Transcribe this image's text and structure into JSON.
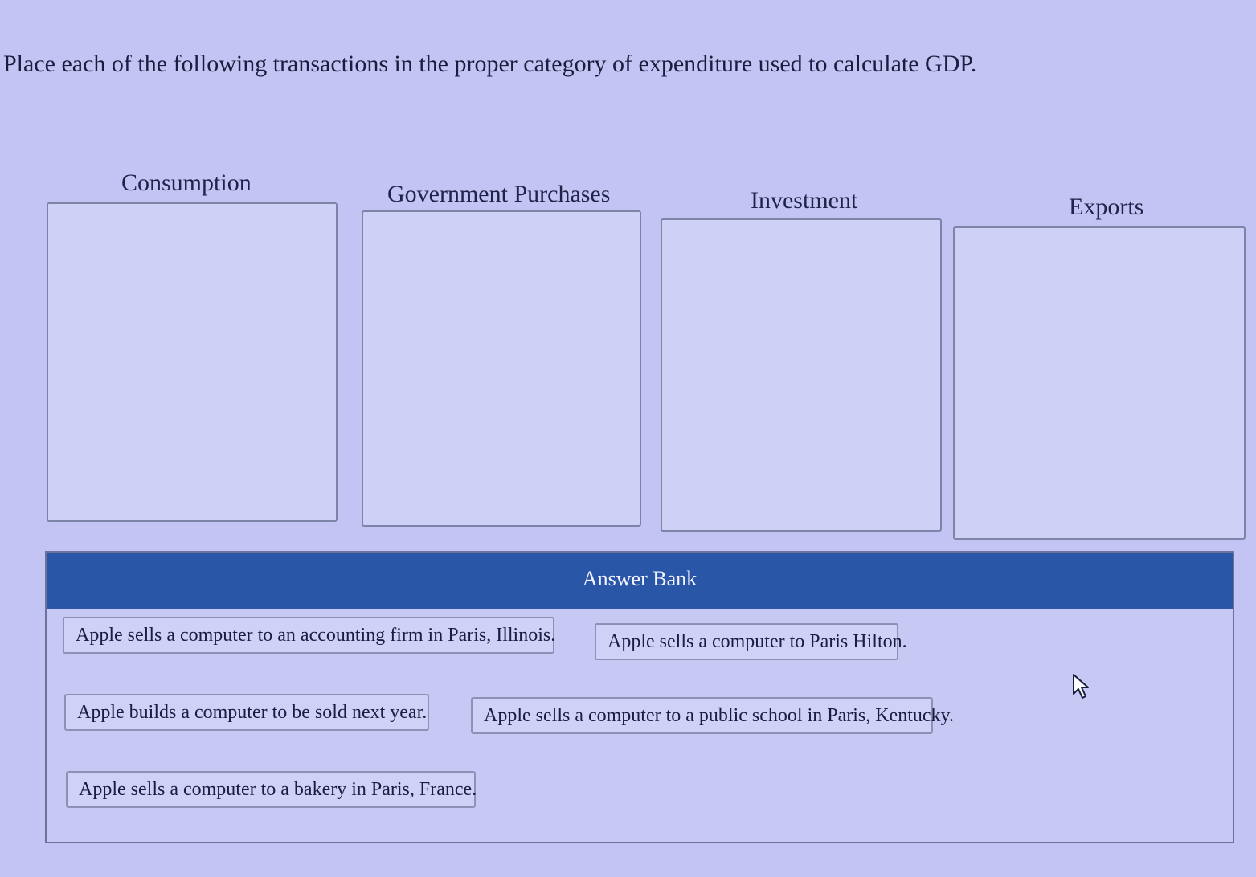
{
  "question": {
    "prompt": "Place each of the following transactions in the proper category of expenditure used to calculate GDP."
  },
  "categories": [
    {
      "label": "Consumption"
    },
    {
      "label": "Government Purchases"
    },
    {
      "label": "Investment"
    },
    {
      "label": "Exports"
    }
  ],
  "answer_bank": {
    "title": "Answer Bank",
    "items": [
      {
        "label": "Apple sells a computer to an accounting firm in Paris, Illinois."
      },
      {
        "label": "Apple sells a computer to Paris Hilton."
      },
      {
        "label": "Apple builds a computer to be sold next year."
      },
      {
        "label": "Apple sells a computer to a public school in Paris, Kentucky."
      },
      {
        "label": "Apple sells a computer to a bakery in Paris, France."
      }
    ]
  },
  "colors": {
    "background": "#c3c4f3",
    "header": "#2a56a8",
    "text": "#1a1d3e"
  },
  "icons": {
    "cursor": "mouse-pointer-icon"
  }
}
